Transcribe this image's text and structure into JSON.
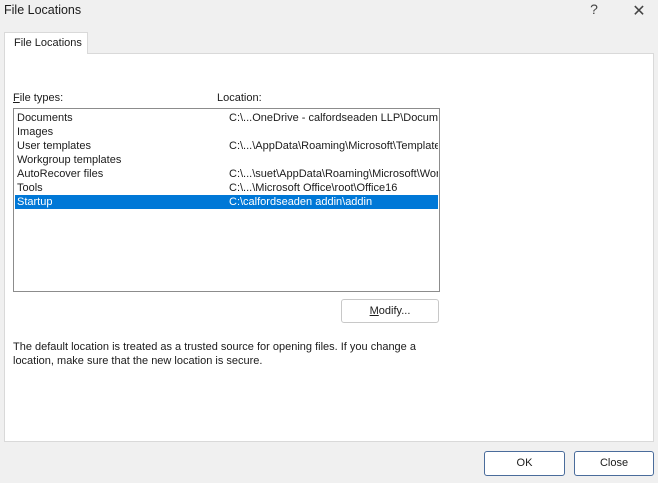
{
  "window": {
    "title": "File Locations",
    "help_glyph": "?",
    "close_glyph": "✕"
  },
  "tabs": [
    {
      "label": "File Locations",
      "active": true
    }
  ],
  "file_types": {
    "header_first": "F",
    "header_rest": "ile types:",
    "location_header": "Location:",
    "rows": [
      {
        "type": "Documents",
        "location": "C:\\...OneDrive - calfordseaden LLP\\Docume...",
        "selected": false
      },
      {
        "type": "Images",
        "location": "",
        "selected": false
      },
      {
        "type": "User templates",
        "location": "C:\\...\\AppData\\Roaming\\Microsoft\\Templates",
        "selected": false
      },
      {
        "type": "Workgroup templates",
        "location": "",
        "selected": false
      },
      {
        "type": "AutoRecover files",
        "location": "C:\\...\\suet\\AppData\\Roaming\\Microsoft\\Word",
        "selected": false
      },
      {
        "type": "Tools",
        "location": "C:\\...\\Microsoft Office\\root\\Office16",
        "selected": false
      },
      {
        "type": "Startup",
        "location": "C:\\calfordseaden addin\\addin",
        "selected": true
      }
    ]
  },
  "modify_button": {
    "label_first": "M",
    "label_rest": "odify..."
  },
  "note": "The default location is treated as a trusted source for opening files. If you change a location, make sure that the new location is secure.",
  "footer": {
    "ok_label": "OK",
    "close_label": "Close"
  },
  "colors": {
    "selection": "#0078d7",
    "background": "#f0f0f0"
  }
}
